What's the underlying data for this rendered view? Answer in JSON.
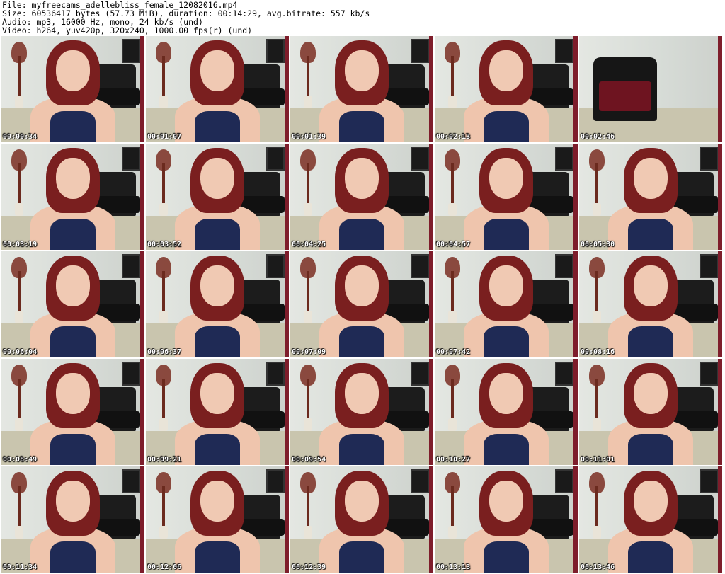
{
  "header": {
    "file_line": "File: myfreecams_adellebliss_female_12082016.mp4",
    "size_line": "Size: 60536417 bytes (57.73 MiB), duration: 00:14:29, avg.bitrate: 557 kb/s",
    "audio_line": "Audio: mp3, 16000 Hz, mono, 24 kb/s (und)",
    "video_line": "Video: h264, yuv420p, 320x240, 1000.00 fps(r) (und)"
  },
  "thumbnails": [
    {
      "timestamp": "00:00:34"
    },
    {
      "timestamp": "00:01:07"
    },
    {
      "timestamp": "00:01:39"
    },
    {
      "timestamp": "00:02:13"
    },
    {
      "timestamp": "00:02:46"
    },
    {
      "timestamp": "00:03:19"
    },
    {
      "timestamp": "00:03:52"
    },
    {
      "timestamp": "00:04:25"
    },
    {
      "timestamp": "00:04:57"
    },
    {
      "timestamp": "00:05:30"
    },
    {
      "timestamp": "00:06:04"
    },
    {
      "timestamp": "00:06:37"
    },
    {
      "timestamp": "00:07:09"
    },
    {
      "timestamp": "00:07:42"
    },
    {
      "timestamp": "00:08:16"
    },
    {
      "timestamp": "00:08:49"
    },
    {
      "timestamp": "00:09:21"
    },
    {
      "timestamp": "00:09:54"
    },
    {
      "timestamp": "00:10:27"
    },
    {
      "timestamp": "00:11:01"
    },
    {
      "timestamp": "00:11:34"
    },
    {
      "timestamp": "00:12:06"
    },
    {
      "timestamp": "00:12:39"
    },
    {
      "timestamp": "00:13:13"
    },
    {
      "timestamp": "00:13:46"
    }
  ]
}
